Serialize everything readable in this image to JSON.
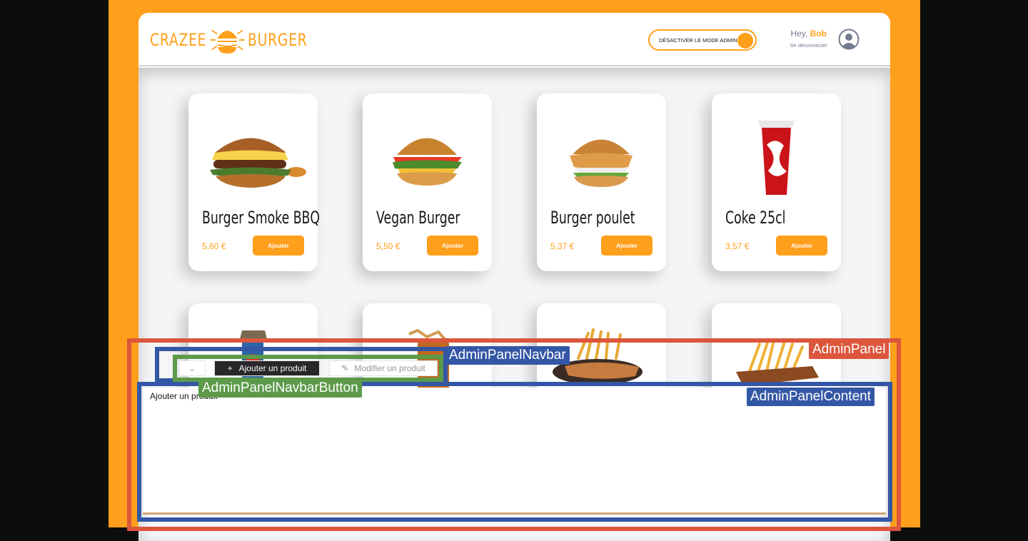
{
  "header": {
    "logo_left": "CRAZEE",
    "logo_right": "BURGER",
    "admin_toggle_label": "DÉSACTIVER LE MODE ADMIN",
    "greeting": "Hey,",
    "username": "Bob",
    "logout_label": "Se déconnecter"
  },
  "menu": {
    "cards": [
      {
        "title": "Burger Smoke BBQ",
        "price": "5,60 €",
        "button": "Ajouter",
        "image_icon": "burger-bbq-image"
      },
      {
        "title": "Vegan Burger",
        "price": "5,50 €",
        "button": "Ajouter",
        "image_icon": "vegan-burger-image"
      },
      {
        "title": "Burger poulet",
        "price": "5,37 €",
        "button": "Ajouter",
        "image_icon": "chicken-burger-image"
      },
      {
        "title": "Coke 25cl",
        "price": "3,57 €",
        "button": "Ajouter",
        "image_icon": "coke-cup-image"
      },
      {
        "title": "",
        "price": "",
        "button": "",
        "image_icon": "drink-can-image"
      },
      {
        "title": "",
        "price": "",
        "button": "",
        "image_icon": "fries-snack-image"
      },
      {
        "title": "",
        "price": "",
        "button": "",
        "image_icon": "hotdog-fries-image"
      },
      {
        "title": "",
        "price": "",
        "button": "",
        "image_icon": "fries-board-image"
      }
    ]
  },
  "admin": {
    "tabs": {
      "add": "Ajouter un produit",
      "edit": "Modifier un produit"
    },
    "content_text": "Ajouter un produit"
  },
  "annotations": {
    "admin_panel": "AdminPanel",
    "admin_panel_navbar": "AdminPanelNavbar",
    "admin_panel_content": "AdminPanelContent",
    "admin_panel_navbar_button": "AdminPanelNavbarButton"
  },
  "colors": {
    "brand": "#ffa01b",
    "background": "#f5f5f7",
    "dark_tab": "#292729",
    "outline_red": "#dc563c",
    "outline_blue": "#3457a5",
    "outline_green": "#5c9a49"
  }
}
